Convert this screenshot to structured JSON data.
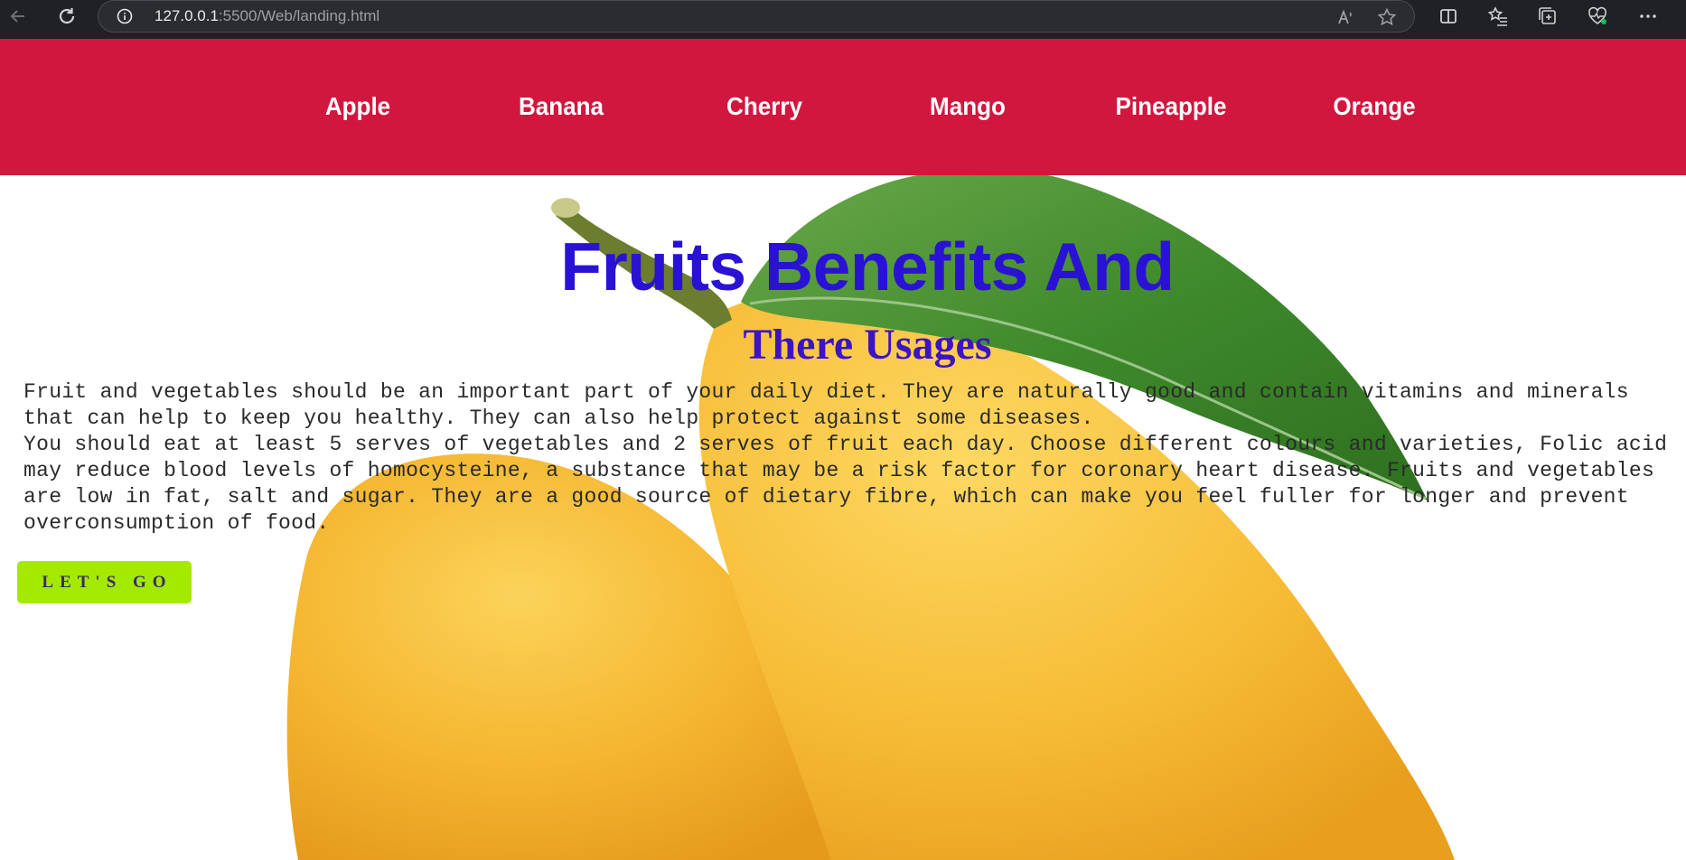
{
  "browser": {
    "url_host": "127.0.0.1",
    "url_rest": ":5500/Web/landing.html",
    "icons": [
      "back-icon",
      "refresh-icon",
      "info-icon",
      "read-aloud-icon",
      "favorite-star-icon",
      "split-screen-icon",
      "favorites-list-icon",
      "collections-icon",
      "health-icon",
      "more-icon"
    ]
  },
  "nav": {
    "items": [
      {
        "label": "Apple"
      },
      {
        "label": "Banana"
      },
      {
        "label": "Cherry"
      },
      {
        "label": "Mango"
      },
      {
        "label": "Pineapple"
      },
      {
        "label": "Orange"
      }
    ],
    "background": "#d2173f"
  },
  "hero": {
    "title": "Fruits Benefits And",
    "subtitle": "There Usages",
    "paragraphs": [
      "Fruit and vegetables should be an important part of your daily diet. They are naturally good and contain vitamins and minerals that can help to keep you healthy. They can also help protect against some diseases.",
      "You should eat at least 5 serves of vegetables and 2 serves of fruit each day. Choose different colours and varieties, Folic acid may reduce blood levels of homocysteine, a substance that may be a risk factor for coronary heart disease. Fruits and vegetables are low in fat, salt and sugar. They are a good source of dietary fibre, which can make you feel fuller for longer and prevent overconsumption of food."
    ],
    "button_label": "LET'S GO",
    "title_color": "#2a12d4",
    "button_color": "#a3ea00",
    "background_image": "mango-with-leaf"
  }
}
